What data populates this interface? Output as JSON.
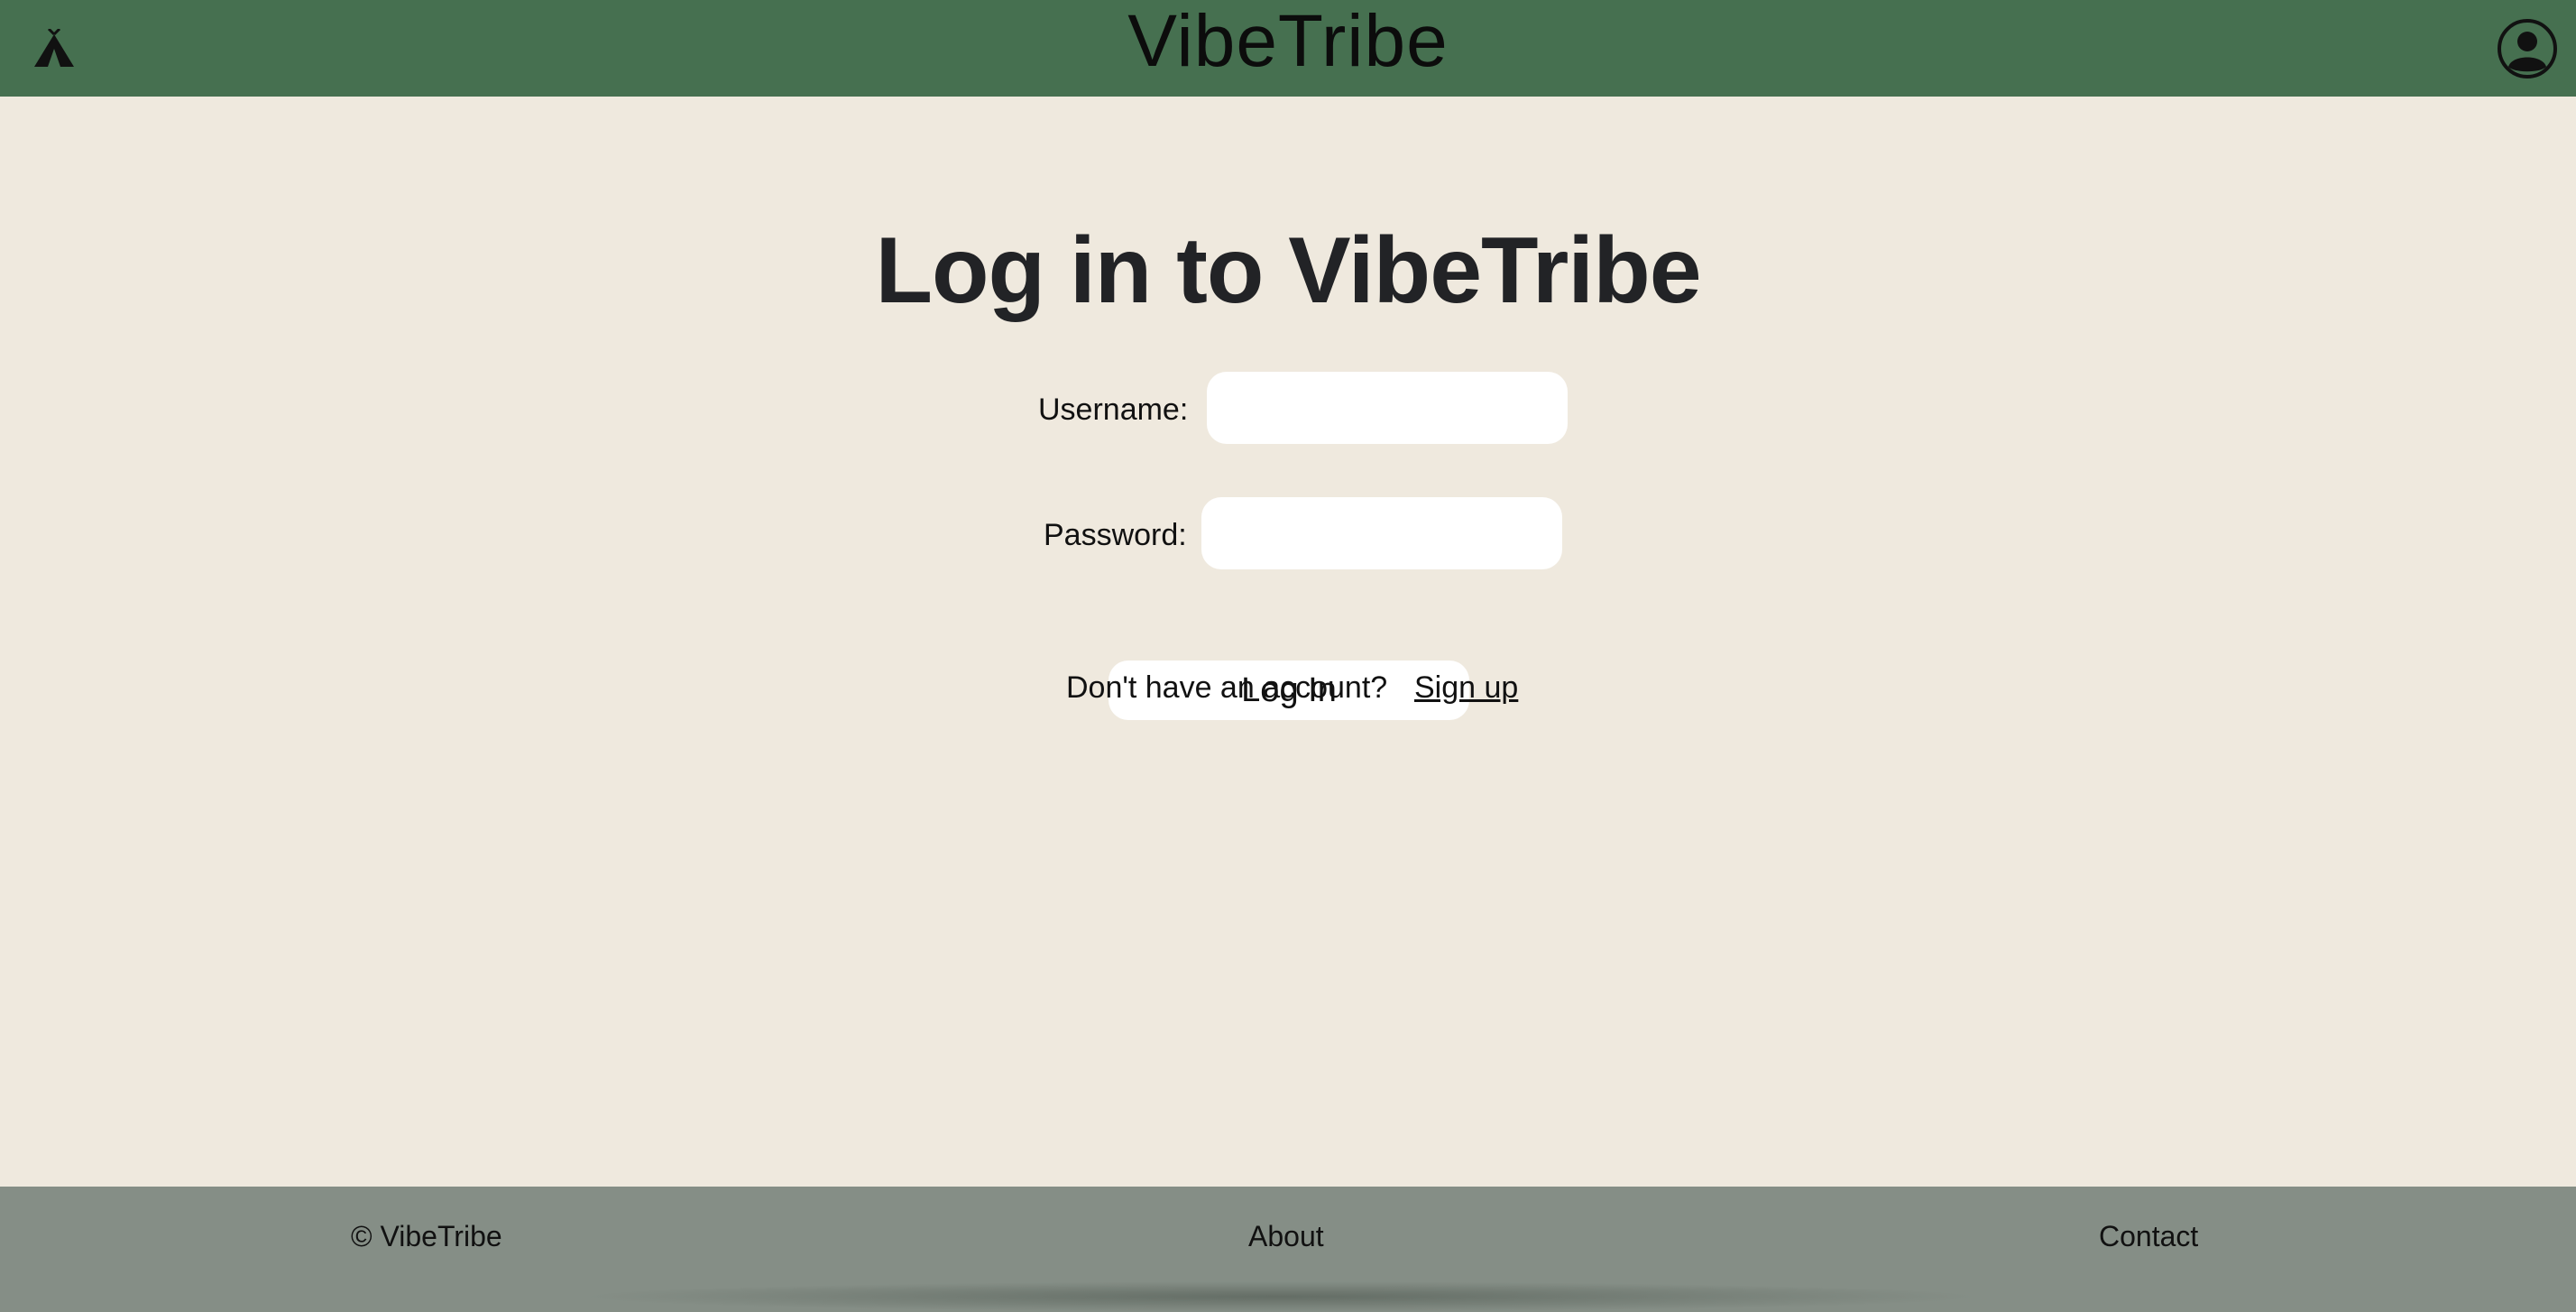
{
  "header": {
    "brand": "VibeTribe",
    "background_color": "#467050",
    "logo_icon": "tent-icon",
    "profile_icon": "user-circle-icon"
  },
  "main": {
    "title": "Log in to VibeTribe",
    "background_color": "#efe9de",
    "username_label": "Username:",
    "username_value": "",
    "password_label": "Password:",
    "password_value": "",
    "login_button": "Log In",
    "signup_prompt": "Don't have an account?",
    "signup_link": "Sign up"
  },
  "footer": {
    "background_color": "#858e86",
    "copyright": "© VibeTribe",
    "about": "About",
    "contact": "Contact"
  }
}
